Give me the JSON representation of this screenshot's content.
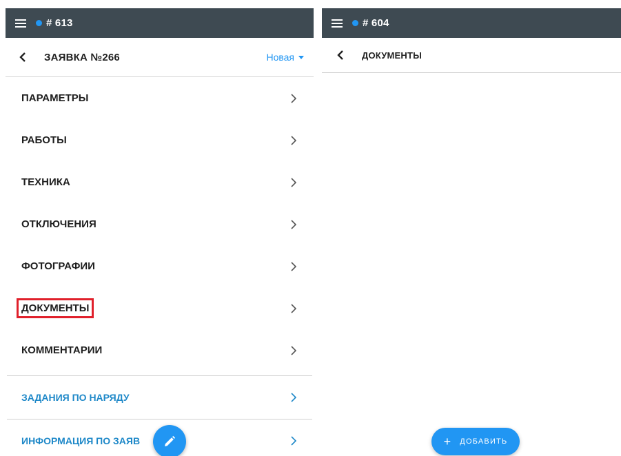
{
  "colors": {
    "topbar": "#3e4a52",
    "accent": "#2196f3",
    "link": "#1e88c8",
    "highlight_border": "#e0202b"
  },
  "left": {
    "topbar": {
      "title": "# 613"
    },
    "header": {
      "title": "ЗАЯВКА №266",
      "status": "Новая"
    },
    "menu": [
      {
        "label": "ПАРАМЕТРЫ"
      },
      {
        "label": "РАБОТЫ"
      },
      {
        "label": "ТЕХНИКА"
      },
      {
        "label": "ОТКЛЮЧЕНИЯ"
      },
      {
        "label": "ФОТОГРАФИИ"
      },
      {
        "label": "ДОКУМЕНТЫ",
        "highlighted": true
      },
      {
        "label": "КОММЕНТАРИИ"
      }
    ],
    "links": [
      {
        "label": "ЗАДАНИЯ ПО НАРЯДУ"
      },
      {
        "label": "ИНФОРМАЦИЯ ПО ЗАЯВ"
      }
    ],
    "fab_icon": "pencil-icon"
  },
  "right": {
    "topbar": {
      "title": "# 604"
    },
    "header": {
      "title": "ДОКУМЕНТЫ"
    },
    "add_button": {
      "label": "ДОБАВИТЬ",
      "icon": "plus-icon"
    }
  }
}
